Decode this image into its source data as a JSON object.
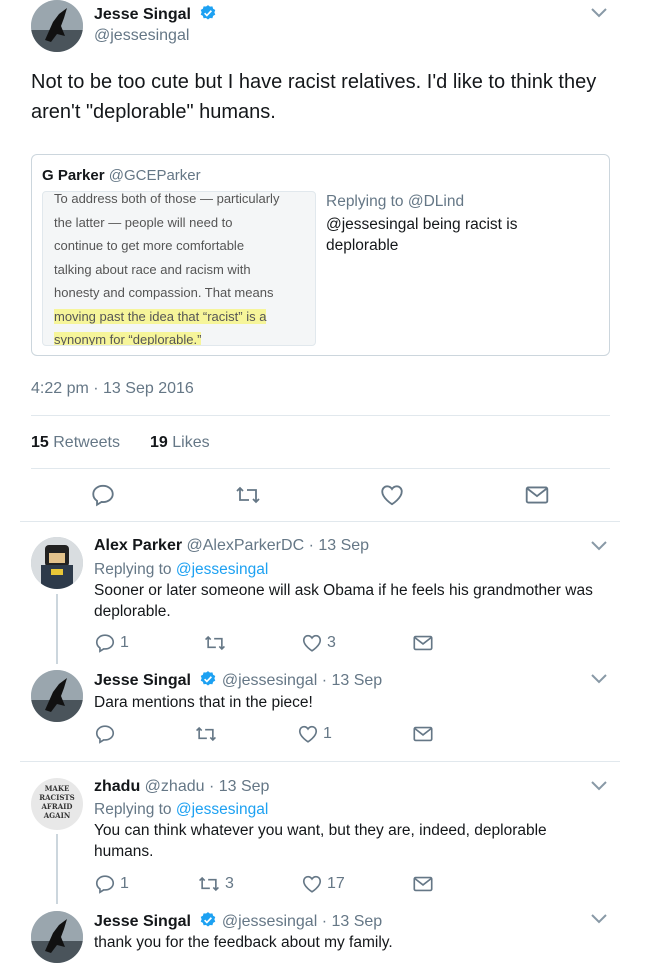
{
  "main_tweet": {
    "author_name": "Jesse Singal",
    "author_handle": "@jessesingal",
    "text": "Not to be too cute but I have racist relatives. I'd like to think they aren't \"deplorable\" humans.",
    "timestamp": "4:22 pm · 13 Sep 2016",
    "retweets_count": "15",
    "retweets_label": "Retweets",
    "likes_count": "19",
    "likes_label": "Likes",
    "quoted": {
      "author_name": "G Parker",
      "author_handle": "@GCEParker",
      "replying_prefix": "Replying to ",
      "replying_to": "@DLind",
      "text": "@jessesingal being racist is deplorable",
      "image_lines": [
        "To address both of those — particularly",
        "the latter — people will need to",
        "continue to get more comfortable",
        "talking about race and racism with",
        "honesty and compassion. That means",
        "moving past the idea that “racist” is a",
        "synonym for “deplorable.”"
      ]
    }
  },
  "replies": [
    {
      "author_name": "Alex Parker",
      "author_handle": "@AlexParkerDC",
      "date": "· 13 Sep",
      "replying_prefix": "Replying to ",
      "replying_to": "@jessesingal",
      "text": "Sooner or later someone will ask Obama if he feels his grandmother was deplorable.",
      "reply_count": "1",
      "retweet_count": "",
      "like_count": "3"
    },
    {
      "author_name": "Jesse Singal",
      "author_handle": "@jessesingal",
      "date": "· 13 Sep",
      "text": "Dara mentions that in the piece!",
      "reply_count": "",
      "retweet_count": "",
      "like_count": "1"
    },
    {
      "author_name": "zhadu",
      "author_handle": "@zhadu",
      "date": "· 13 Sep",
      "avatar_text": [
        "MAKE",
        "RACISTS",
        "AFRAID",
        "AGAIN"
      ],
      "replying_prefix": "Replying to ",
      "replying_to": "@jessesingal",
      "text": "You can think whatever you want, but they are, indeed, deplorable humans.",
      "reply_count": "1",
      "retweet_count": "3",
      "like_count": "17"
    },
    {
      "author_name": "Jesse Singal",
      "author_handle": "@jessesingal",
      "date": "· 13 Sep",
      "text": "thank you for the feedback about my family."
    }
  ],
  "icons": {
    "verified": "verified-badge-icon",
    "chevron": "chevron-down-icon",
    "reply": "reply-icon",
    "retweet": "retweet-icon",
    "like": "heart-icon",
    "share": "share-icon"
  },
  "colors": {
    "accent": "#1da1f2",
    "text": "#14171a",
    "secondary": "#657786",
    "border": "#e1e8ed"
  }
}
